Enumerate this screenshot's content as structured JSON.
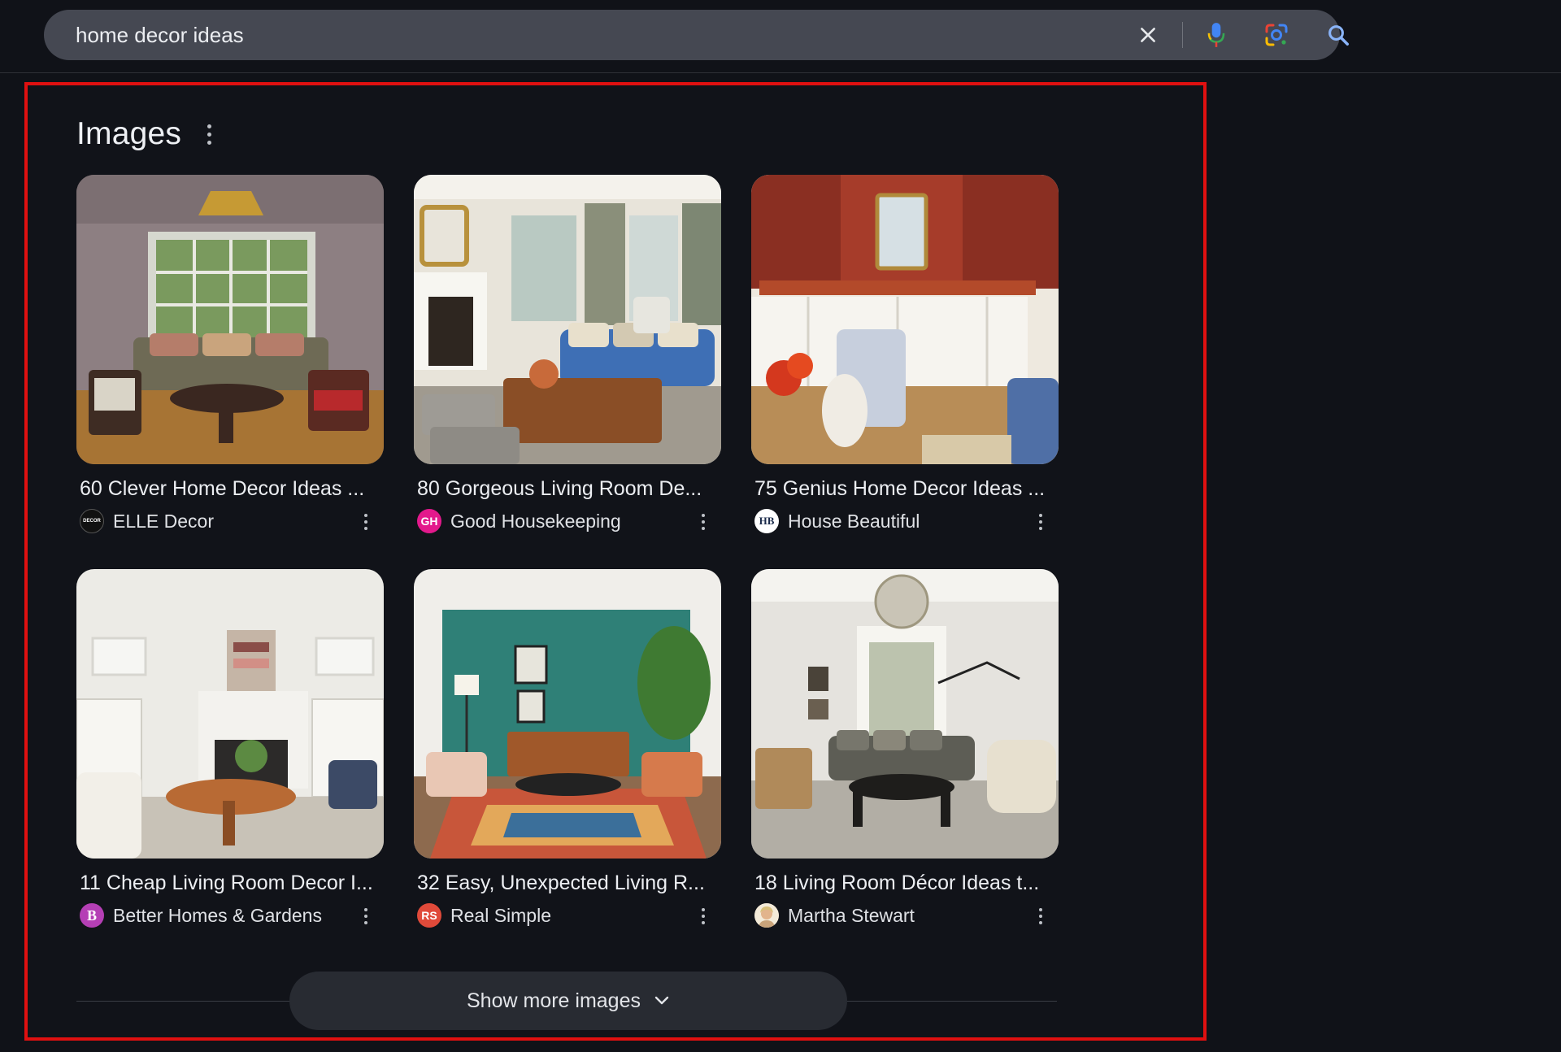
{
  "search": {
    "query": "home decor ideas",
    "icons": [
      "close-icon",
      "microphone-icon",
      "google-lens-icon",
      "search-icon"
    ]
  },
  "images_section": {
    "title": "Images",
    "results": [
      {
        "title": "60 Clever Home Decor Ideas ...",
        "source": "ELLE Decor",
        "favicon_text": "DECOR",
        "favicon_color": "#111111"
      },
      {
        "title": "80 Gorgeous Living Room De...",
        "source": "Good Housekeeping",
        "favicon_text": "GH",
        "favicon_color": "#e3198c"
      },
      {
        "title": "75 Genius Home Decor Ideas ...",
        "source": "House Beautiful",
        "favicon_text": "HB",
        "favicon_color": "#ffffff"
      },
      {
        "title": "11 Cheap Living Room Decor I...",
        "source": "Better Homes & Gardens",
        "favicon_text": "B",
        "favicon_color": "#b53fb5"
      },
      {
        "title": "32 Easy, Unexpected Living R...",
        "source": "Real Simple",
        "favicon_text": "RS",
        "favicon_color": "#e04a3a"
      },
      {
        "title": "18 Living Room Décor Ideas t...",
        "source": "Martha Stewart",
        "favicon_text": "",
        "favicon_color": "#e9dcc8"
      }
    ],
    "show_more_label": "Show more images"
  },
  "colors": {
    "background": "#101218",
    "search_box": "#454852",
    "highlight_border": "#e01010",
    "show_more_button": "#282b32"
  }
}
